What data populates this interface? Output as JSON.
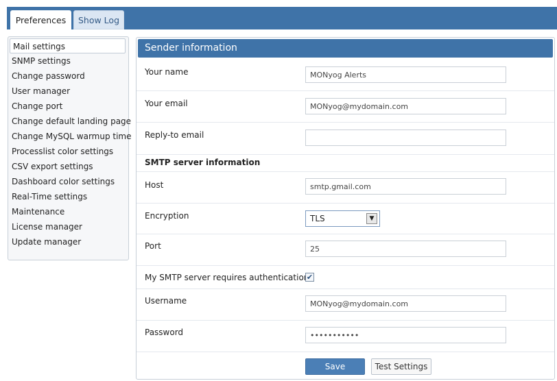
{
  "tabs": [
    {
      "label": "Preferences",
      "active": true
    },
    {
      "label": "Show Log",
      "active": false
    }
  ],
  "sidebar": {
    "items": [
      {
        "label": "Mail settings",
        "selected": true
      },
      {
        "label": "SNMP settings"
      },
      {
        "label": "Change password"
      },
      {
        "label": "User manager"
      },
      {
        "label": "Change port"
      },
      {
        "label": "Change default landing page"
      },
      {
        "label": "Change MySQL warmup time"
      },
      {
        "label": "Processlist color settings"
      },
      {
        "label": "CSV export settings"
      },
      {
        "label": "Dashboard color settings"
      },
      {
        "label": "Real-Time settings"
      },
      {
        "label": "Maintenance"
      },
      {
        "label": "License manager"
      },
      {
        "label": "Update manager"
      }
    ]
  },
  "panel": {
    "title": "Sender information",
    "your_name": {
      "label": "Your name",
      "value": "MONyog Alerts"
    },
    "your_email": {
      "label": "Your email",
      "value": "MONyog@mydomain.com"
    },
    "reply_to": {
      "label": "Reply-to email",
      "value": ""
    },
    "smtp_section": "SMTP server information",
    "host": {
      "label": "Host",
      "value": "smtp.gmail.com"
    },
    "encryption": {
      "label": "Encryption",
      "value": "TLS"
    },
    "port": {
      "label": "Port",
      "value": "25"
    },
    "auth": {
      "label": "My SMTP server requires authentication",
      "checked": true,
      "check_glyph": "✔"
    },
    "username": {
      "label": "Username",
      "value": "MONyog@mydomain.com"
    },
    "password": {
      "label": "Password",
      "value": "•••••••••••"
    },
    "save_label": "Save",
    "test_label": "Test Settings"
  },
  "colors": {
    "header_blue": "#3f73a8",
    "save_button": "#4b7fb6"
  }
}
